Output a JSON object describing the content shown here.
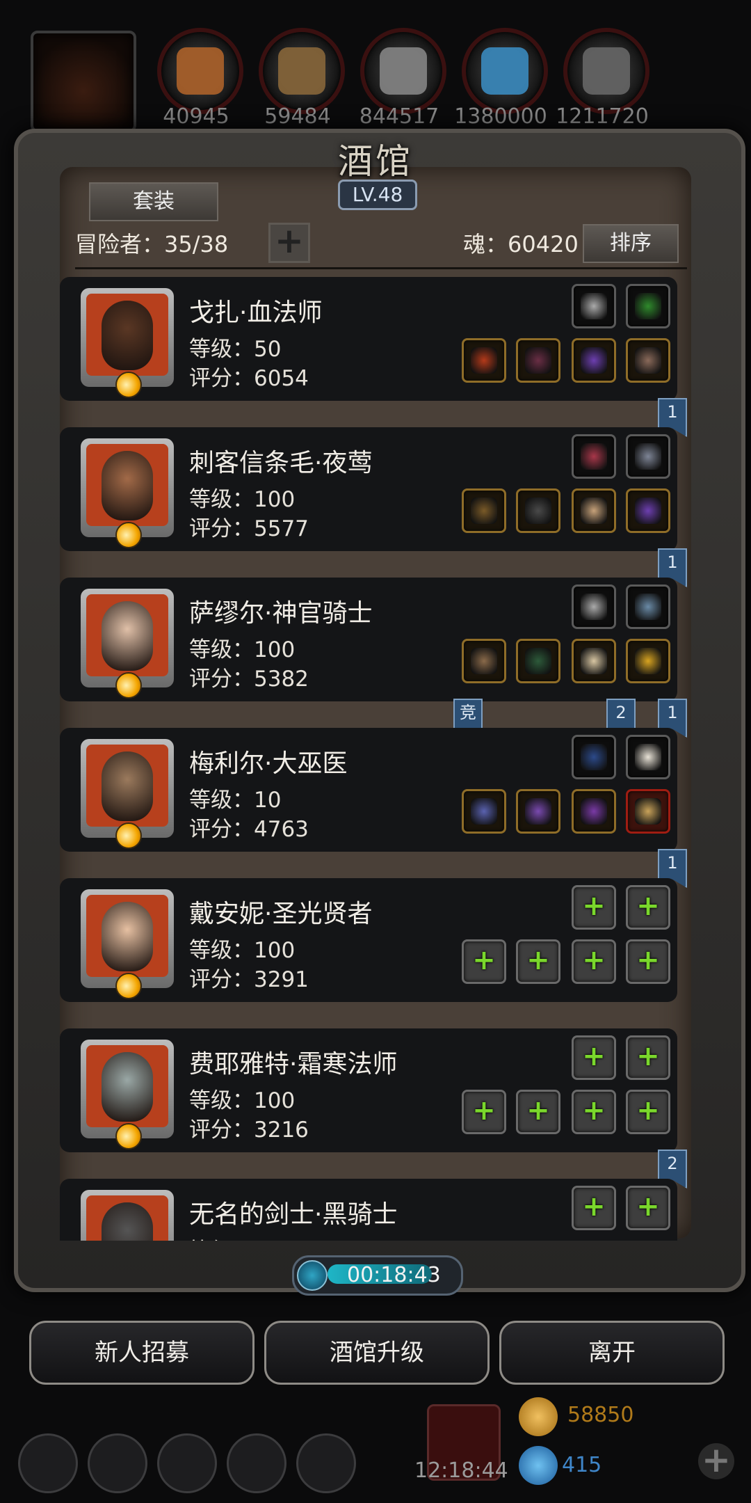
{
  "top": {
    "resources": [
      {
        "icon": "food-icon",
        "value": "40945",
        "color": "#b4652a"
      },
      {
        "icon": "wood-icon",
        "value": "59484",
        "color": "#8d6a3b"
      },
      {
        "icon": "iron-icon",
        "value": "844517",
        "color": "#8a8a8a"
      },
      {
        "icon": "crystal-icon",
        "value": "1380000",
        "color": "#3b8fc7"
      },
      {
        "icon": "ore-icon",
        "value": "1211720",
        "color": "#6a6a6a"
      }
    ]
  },
  "panel": {
    "title": "酒馆",
    "level": "LV.48",
    "set_button": "套装",
    "adventurers_label": "冒险者：35/38",
    "soul_label": "魂：60420",
    "sort_button": "排序"
  },
  "heroes": [
    {
      "name": "戈扎·血法师",
      "level": "等级：50",
      "score": "评分：6054",
      "skin": "#5a3724",
      "top_slots": [
        {
          "icon": "dagger-icon",
          "c": "#aaa",
          "b": "gray"
        },
        {
          "icon": "scroll-icon",
          "c": "#2f8a2c",
          "b": "gray"
        }
      ],
      "bottom_slots": [
        {
          "icon": "staff-icon",
          "c": "#b43a1a",
          "b": "gold"
        },
        {
          "icon": "cloak-icon",
          "c": "#6a2e45",
          "b": "gold"
        },
        {
          "icon": "ring-icon",
          "c": "#6d3fb0",
          "b": "gold"
        },
        {
          "icon": "bracer-icon",
          "c": "#8a6a5a",
          "b": "gold"
        }
      ],
      "flags": [
        "1"
      ]
    },
    {
      "name": "刺客信条毛·夜莺",
      "level": "等级：100",
      "score": "评分：5577",
      "skin": "#a26a48",
      "top_slots": [
        {
          "icon": "boots-icon",
          "c": "#a8374a",
          "b": "gray"
        },
        {
          "icon": "amulet-icon",
          "c": "#7e8596",
          "b": "gray"
        }
      ],
      "bottom_slots": [
        {
          "icon": "bow-icon",
          "c": "#7a5a28",
          "b": "gold"
        },
        {
          "icon": "armor-icon",
          "c": "#4a4a4a",
          "b": "gold"
        },
        {
          "icon": "skull-icon",
          "c": "#c7a27a",
          "b": "gold"
        },
        {
          "icon": "ring-icon",
          "c": "#6d3fb0",
          "b": "gold"
        }
      ],
      "flags": [
        "1"
      ]
    },
    {
      "name": "萨缪尔·神官骑士",
      "level": "等级：100",
      "score": "评分：5382",
      "skin": "#e0c0a8",
      "top_slots": [
        {
          "icon": "dagger-icon",
          "c": "#aaa",
          "b": "gray"
        },
        {
          "icon": "necklace-icon",
          "c": "#6a8aa6",
          "b": "gray"
        }
      ],
      "bottom_slots": [
        {
          "icon": "hammer-icon",
          "c": "#8a6a4a",
          "b": "gold"
        },
        {
          "icon": "cloak-icon",
          "c": "#2d5a3a",
          "b": "gold"
        },
        {
          "icon": "gauntlet-icon",
          "c": "#d8c6a2",
          "b": "gold"
        },
        {
          "icon": "gold-ring-icon",
          "c": "#d8a421",
          "b": "gold"
        }
      ],
      "flags": [
        "竞",
        "2",
        "1"
      ]
    },
    {
      "name": "梅利尔·大巫医",
      "level": "等级：10",
      "score": "评分：4763",
      "skin": "#9b7a5d",
      "top_slots": [
        {
          "icon": "whip-icon",
          "c": "#2c4a8a",
          "b": "gray"
        },
        {
          "icon": "fur-icon",
          "c": "#e8e2d6",
          "b": "gray"
        }
      ],
      "bottom_slots": [
        {
          "icon": "wand-icon",
          "c": "#5a62b0",
          "b": "gold"
        },
        {
          "icon": "armor-icon",
          "c": "#7a4ab0",
          "b": "gold"
        },
        {
          "icon": "sword-icon",
          "c": "#7a3aa6",
          "b": "gold"
        },
        {
          "icon": "orb-icon",
          "c": "#c9a35a",
          "b": "red"
        }
      ],
      "flags": [
        "1"
      ]
    },
    {
      "name": "戴安妮·圣光贤者",
      "level": "等级：100",
      "score": "评分：3291",
      "skin": "#e6c0a2",
      "top_slots": [
        {
          "icon": "add-icon",
          "b": "add"
        },
        {
          "icon": "add-icon",
          "b": "add"
        }
      ],
      "bottom_slots": [
        {
          "icon": "add-icon",
          "b": "add"
        },
        {
          "icon": "add-icon",
          "b": "add"
        },
        {
          "icon": "add-icon",
          "b": "add"
        },
        {
          "icon": "add-icon",
          "b": "add"
        }
      ],
      "flags": []
    },
    {
      "name": "费耶雅特·霜寒法师",
      "level": "等级：100",
      "score": "评分：3216",
      "skin": "#9aa8a6",
      "top_slots": [
        {
          "icon": "add-icon",
          "b": "add"
        },
        {
          "icon": "add-icon",
          "b": "add"
        }
      ],
      "bottom_slots": [
        {
          "icon": "add-icon",
          "b": "add"
        },
        {
          "icon": "add-icon",
          "b": "add"
        },
        {
          "icon": "add-icon",
          "b": "add"
        },
        {
          "icon": "add-icon",
          "b": "add"
        }
      ],
      "flags": [
        "2"
      ]
    },
    {
      "name": "无名的剑士·黑骑士",
      "level": "等级",
      "score": "",
      "skin": "#555",
      "top_slots": [
        {
          "icon": "add-icon",
          "b": "add"
        },
        {
          "icon": "add-icon",
          "b": "add"
        }
      ],
      "bottom_slots": [],
      "flags": []
    }
  ],
  "timer": "00:18:43",
  "buttons": {
    "recruit": "新人招募",
    "upgrade": "酒馆升级",
    "leave": "离开"
  },
  "bottom": {
    "clock": "12:18:44",
    "gold": "58850",
    "gems": "415",
    "nav_icons": [
      "settings-icon",
      "star-icon",
      "hero-icon",
      "mail-icon",
      "guild-icon"
    ]
  }
}
